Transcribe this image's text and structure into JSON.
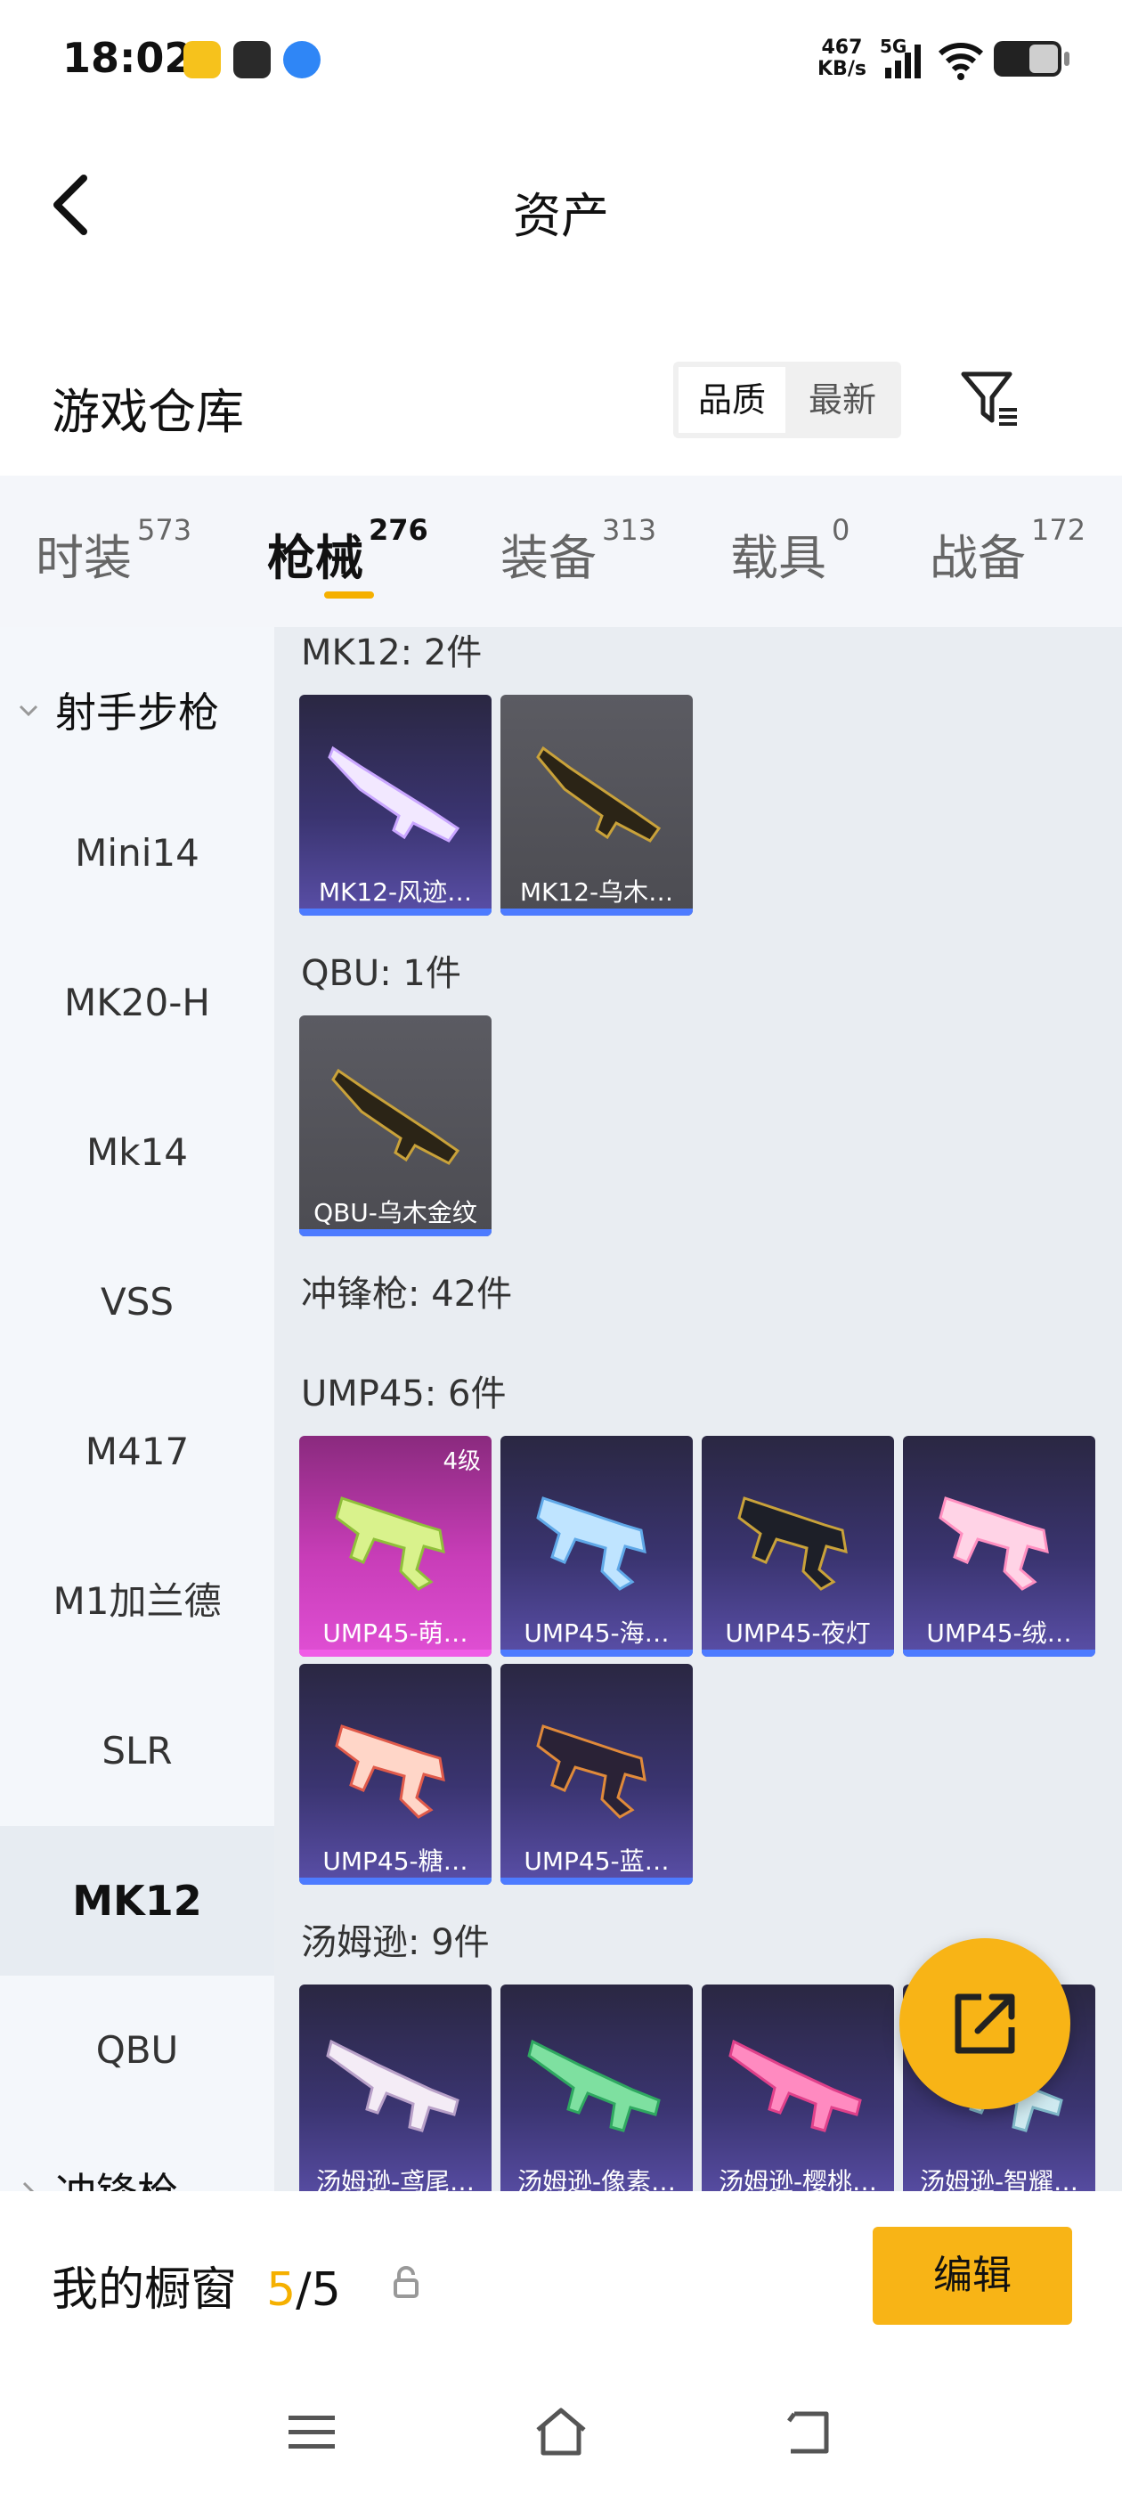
{
  "status": {
    "time": "18:02",
    "speed_value": "467",
    "speed_unit": "KB/s",
    "network": "5G"
  },
  "header": {
    "title": "资产"
  },
  "warehouse": {
    "title": "游戏仓库",
    "sort_options": [
      "品质",
      "最新"
    ],
    "selected_sort": "品质"
  },
  "tabs": [
    {
      "label": "时装",
      "count": "573"
    },
    {
      "label": "枪械",
      "count": "276",
      "active": true
    },
    {
      "label": "装备",
      "count": "313"
    },
    {
      "label": "载具",
      "count": "0"
    },
    {
      "label": "战备",
      "count": "172"
    }
  ],
  "sidebar": {
    "group": "射手步枪",
    "items": [
      "Mini14",
      "MK20-H",
      "Mk14",
      "VSS",
      "M417",
      "M1加兰德",
      "SLR",
      "MK12",
      "QBU"
    ],
    "active_item": "MK12",
    "next_group_partial": "冲锋枪"
  },
  "content": {
    "sections": [
      {
        "title": "MK12: 2件",
        "items": [
          "MK12-风迹…",
          "MK12-乌木…"
        ]
      },
      {
        "title": "QBU: 1件",
        "items": [
          "QBU-乌木金纹"
        ]
      },
      {
        "title": "冲锋枪: 42件",
        "items": []
      },
      {
        "title": "UMP45: 6件",
        "items": [
          "UMP45-萌…",
          "UMP45-海…",
          "UMP45-夜灯",
          "UMP45-绒…",
          "UMP45-糖…",
          "UMP45-蓝…"
        ]
      },
      {
        "title": "汤姆逊: 9件",
        "items": [
          "汤姆逊-鸢尾…",
          "汤姆逊-像素…",
          "汤姆逊-樱桃…",
          "汤姆逊-智耀…"
        ]
      }
    ],
    "level_badge": "4级"
  },
  "showcase": {
    "label": "我的橱窗",
    "current": "5",
    "separator": "/",
    "max": "5",
    "edit_label": "编辑"
  },
  "colors": {
    "accent": "#f8b416",
    "tab_indicator": "#f5b000",
    "rarity_purple_bar": "#4d7bff",
    "rarity_pink_bar": "#f05ce6"
  },
  "icons": [
    "back-icon",
    "filter-icon",
    "chevron-down-icon",
    "share-icon",
    "lock-icon",
    "menu-icon",
    "home-icon",
    "return-icon"
  ]
}
